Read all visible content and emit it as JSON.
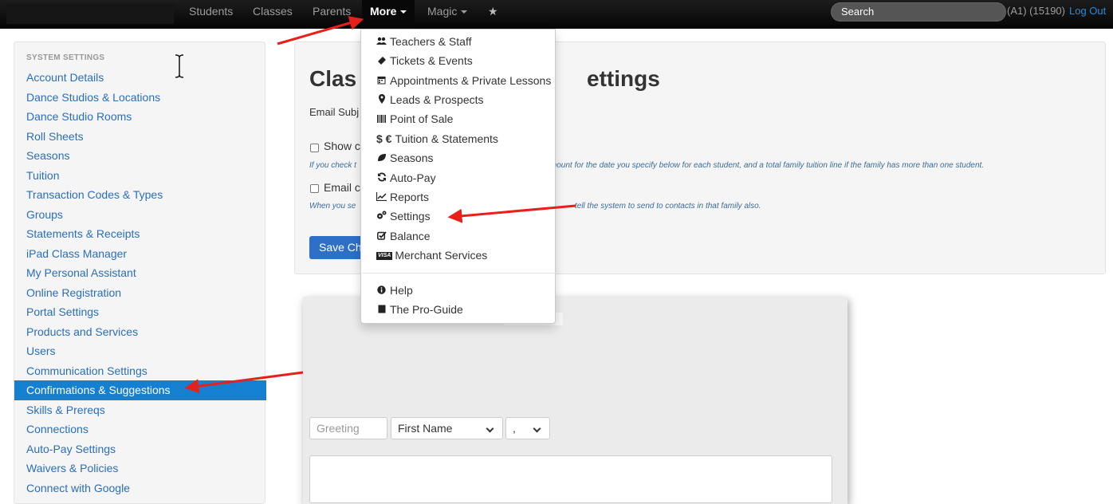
{
  "navbar": {
    "items": [
      {
        "label": "Students"
      },
      {
        "label": "Classes"
      },
      {
        "label": "Parents"
      },
      {
        "label": "More",
        "active": true
      },
      {
        "label": "Magic"
      }
    ],
    "star_icon": "★",
    "search_placeholder": "Search",
    "account": "(A1) (15190)",
    "logout": "Log Out"
  },
  "sidebar": {
    "header": "SYSTEM SETTINGS",
    "items": [
      "Account Details",
      "Dance Studios & Locations",
      "Dance Studio Rooms",
      "Roll Sheets",
      "Seasons",
      "Tuition",
      "Transaction Codes & Types",
      "Groups",
      "Statements & Receipts",
      "iPad Class Manager",
      "My Personal Assistant",
      "Online Registration",
      "Portal Settings",
      "Products and Services",
      "Users",
      "Communication Settings",
      "Confirmations & Suggestions",
      "Skills & Prereqs",
      "Connections",
      "Auto-Pay Settings",
      "Waivers & Policies",
      "Connect with Google"
    ],
    "active_index": 16,
    "active_color": "#1580d0"
  },
  "panel": {
    "title_start": "Clas",
    "title_end": "ettings",
    "email_subject": "Email Subj",
    "checkbox1_label": "Show ca",
    "help1_start": "If you check t",
    "help1_end": "e amount for the date you specify below for each student, and a total family tuition line if the family has more than one student.",
    "checkbox2_label": "Email co",
    "help2_start": "When you se",
    "help2_end": "tell the system to send to contacts in that family also.",
    "save_button": "Save Cha"
  },
  "editor": {
    "greeting_placeholder": "Greeting",
    "first_name_select": "First Name",
    "punct_select": ","
  },
  "more_menu": {
    "items": [
      {
        "icon": "users-icon",
        "label": "Teachers & Staff"
      },
      {
        "icon": "ticket-icon",
        "label": "Tickets & Events"
      },
      {
        "icon": "calendar-icon",
        "label": "Appointments & Private Lessons"
      },
      {
        "icon": "map-marker-icon",
        "label": "Leads & Prospects"
      },
      {
        "icon": "barcode-icon",
        "label": "Point of Sale"
      },
      {
        "icon": "currency-icon",
        "label": "Tuition & Statements",
        "prefix": "$ €"
      },
      {
        "icon": "leaf-icon",
        "label": "Seasons"
      },
      {
        "icon": "refresh-icon",
        "label": "Auto-Pay"
      },
      {
        "icon": "chart-line-icon",
        "label": "Reports"
      },
      {
        "icon": "cogs-icon",
        "label": "Settings"
      },
      {
        "icon": "check-square-icon",
        "label": "Balance"
      },
      {
        "icon": "visa-card-icon",
        "label": "Merchant Services",
        "badge": "VISA"
      },
      {
        "icon": "info-circle-icon",
        "label": "Help"
      },
      {
        "icon": "book-icon",
        "label": "The Pro-Guide"
      }
    ]
  },
  "colors": {
    "link": "#2a6ebb",
    "annotation_arrow": "#e8201a",
    "save_button": "#2e6fc8"
  }
}
